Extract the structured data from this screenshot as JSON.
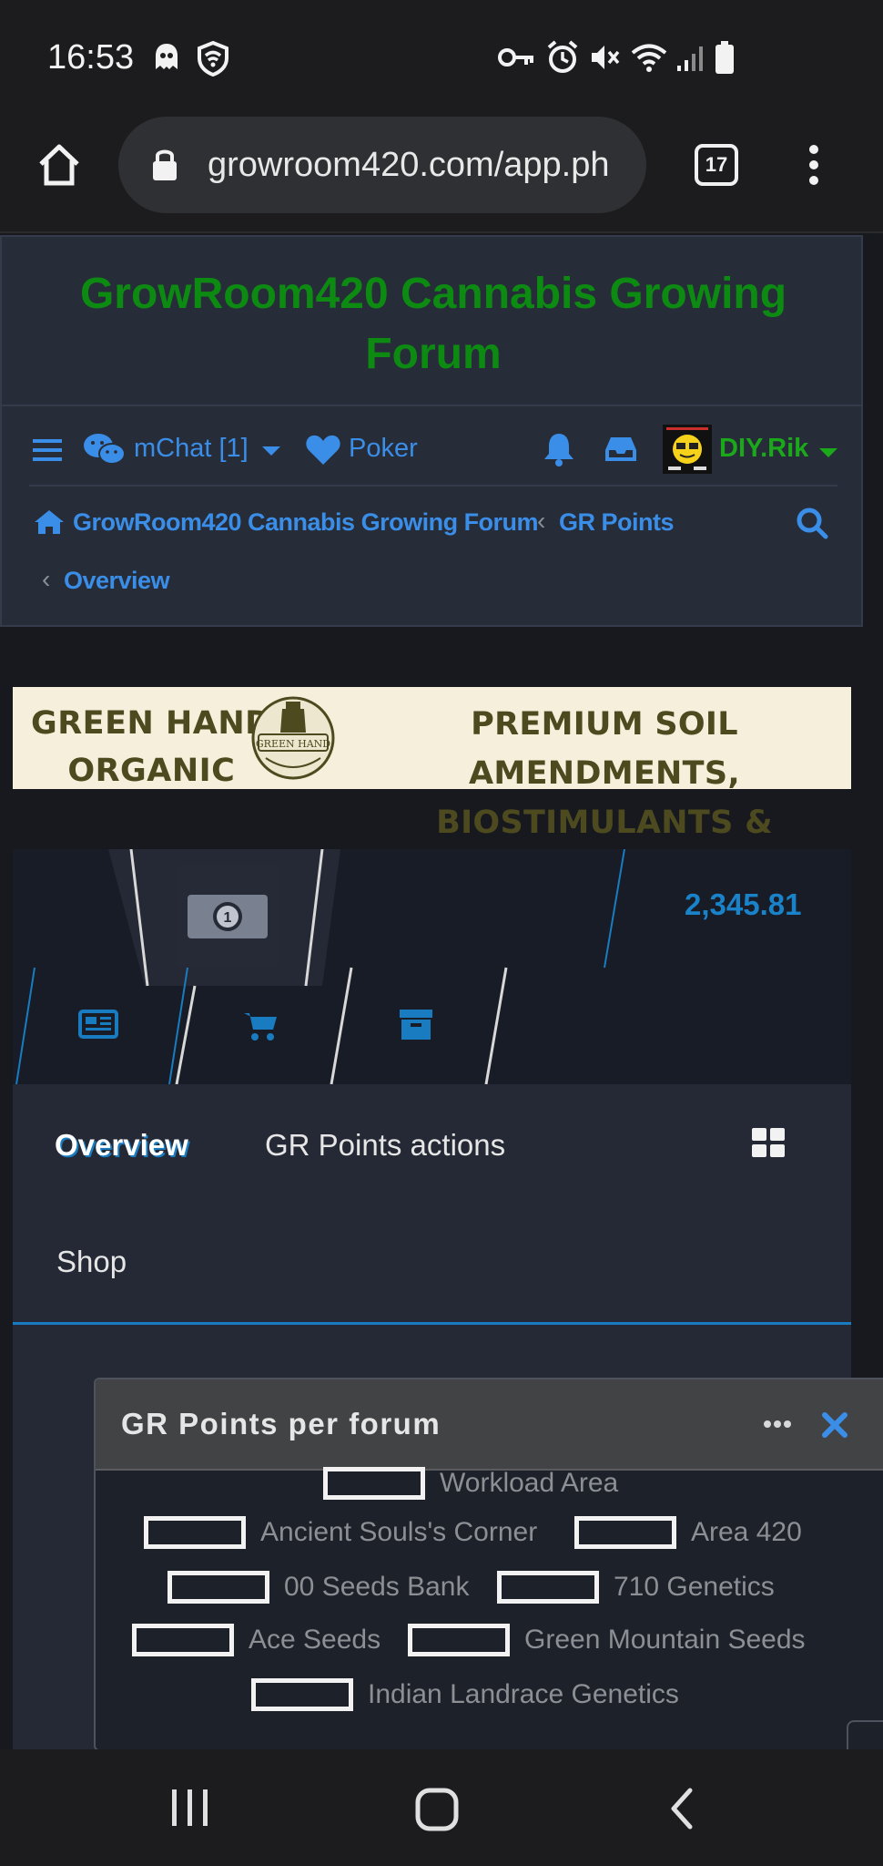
{
  "status_bar": {
    "time": "16:53",
    "left_icons": [
      "ghost-icon",
      "shield-wifi-icon"
    ],
    "right_icons": [
      "vpn-key-icon",
      "alarm-icon",
      "mute-icon",
      "wifi-icon",
      "signal-icon",
      "battery-icon"
    ]
  },
  "browser": {
    "url": "growroom420.com/app.ph",
    "tab_count": "17",
    "home_icon": "home-icon",
    "lock_icon": "lock-icon",
    "menu_icon": "more-vert-icon"
  },
  "forum": {
    "title": "GrowRoom420 Cannabis Growing Forum",
    "title_color": "#0c8a12",
    "nav": {
      "mchat_label": "mChat [1]",
      "poker_label": "Poker",
      "username": "DIY.Rik",
      "username_color": "#1ba81b"
    },
    "breadcrumb": {
      "home": "GrowRoom420 Cannabis Growing Forum",
      "section": "GR Points",
      "current": "Overview"
    },
    "accent_color": "#3a8ee8"
  },
  "banner": {
    "left_line1": "GREEN HAND",
    "left_line2": "ORGANIC",
    "logo_text": "GREEN HAND",
    "right_line1": "PREMIUM SOIL AMENDMENTS,",
    "right_line2": "BIOSTIMULANTS & COVERCROPS"
  },
  "points": {
    "value": "2,345.81",
    "value_color": "#1a82c8",
    "icons": [
      "newspaper-icon",
      "cart-icon",
      "archive-icon"
    ]
  },
  "tabs": {
    "overview": "Overview",
    "actions": "GR Points actions",
    "shop": "Shop",
    "grid_icon": "grid-icon"
  },
  "modal": {
    "title": "GR Points per forum",
    "items": [
      "Workload Area",
      "Ancient Souls's Corner",
      "Area 420",
      "00 Seeds Bank",
      "710 Genetics",
      "Ace Seeds",
      "Green Mountain Seeds",
      "Indian Landrace Genetics"
    ]
  },
  "system_nav": [
    "recents-icon",
    "home-circle-icon",
    "back-icon"
  ]
}
